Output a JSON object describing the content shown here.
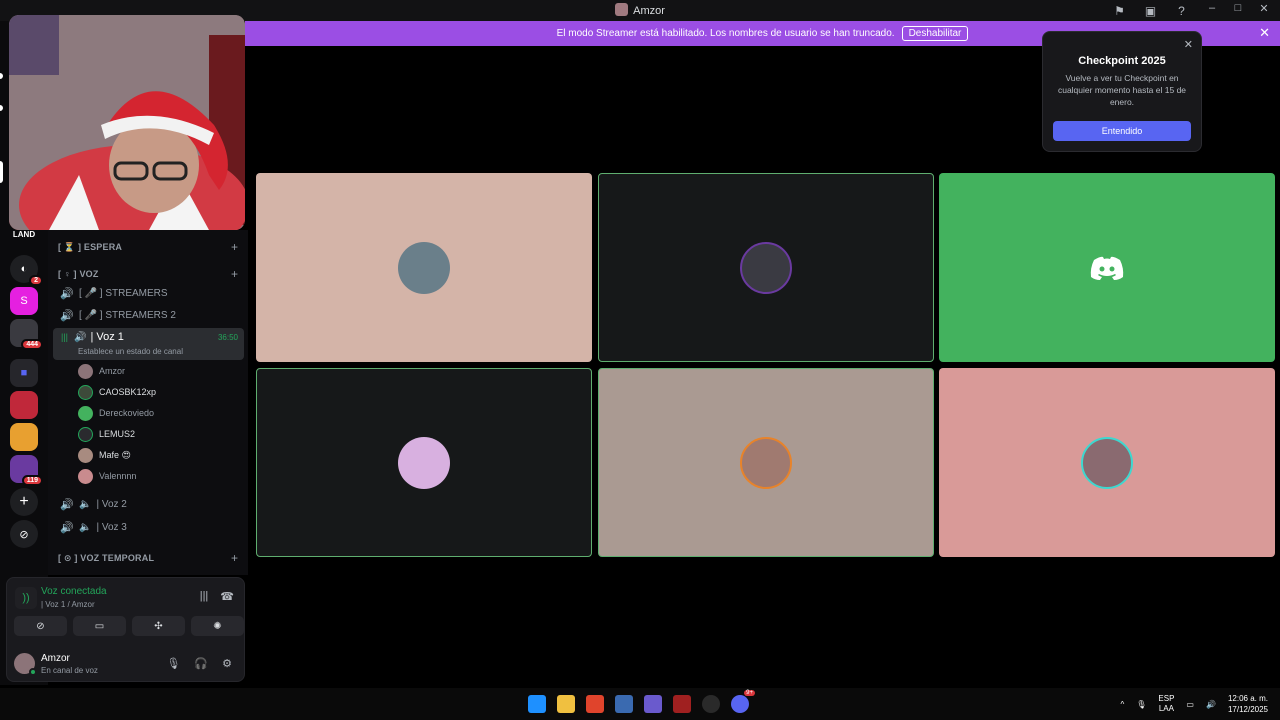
{
  "window": {
    "title": "Amzor",
    "min": "–",
    "max": "□",
    "close": "✕"
  },
  "streamer_banner": {
    "text": "El modo Streamer está habilitado. Los nombres de usuario se han truncado.",
    "button": "Deshabilitar",
    "close": "✕"
  },
  "popup": {
    "title": "Checkpoint 2025",
    "body": "Vuelve a ver tu Checkpoint en cualquier momento hasta el 15 de enero.",
    "button": "Entendido",
    "close": "✕"
  },
  "rail": {
    "logo_text": "LAND",
    "badges": [
      "2",
      "444",
      "119"
    ],
    "s_server": "S",
    "add": "+",
    "explore": "⊘"
  },
  "channels": {
    "cat_espera": "[ ⏳ ] ESPERA",
    "cat_voz": "[ ♀ ] VOZ",
    "streamers": "[ 🎤 ] STREAMERS",
    "streamers2": "[ 🎤 ] STREAMERS 2",
    "active": {
      "name": "| Voz 1",
      "time": "36:50",
      "status": "Establece un estado de canal"
    },
    "voz2": "| Voz 2",
    "voz3": "| Voz 3",
    "cat_temporal": "[ ⊙ ] VOZ TEMPORAL"
  },
  "voice_users": [
    "Amzor",
    "CAOSBK12xp",
    "Dereckoviedo",
    "LEMUS2",
    "Mafe 😍",
    "Valennnn"
  ],
  "voice_panel": {
    "title": "Voz conectada",
    "subtitle": "| Voz 1 / Amzor"
  },
  "user": {
    "name": "Amzor",
    "status": "En canal de voz"
  },
  "taskbar": {
    "lang1": "ESP",
    "lang2": "LAA",
    "time": "12:06 a. m.",
    "date": "17/12/2025",
    "badge": "9+"
  },
  "colors": {
    "accent": "#5865f2",
    "streamer": "#9b4ee4",
    "green": "#23a55a"
  }
}
